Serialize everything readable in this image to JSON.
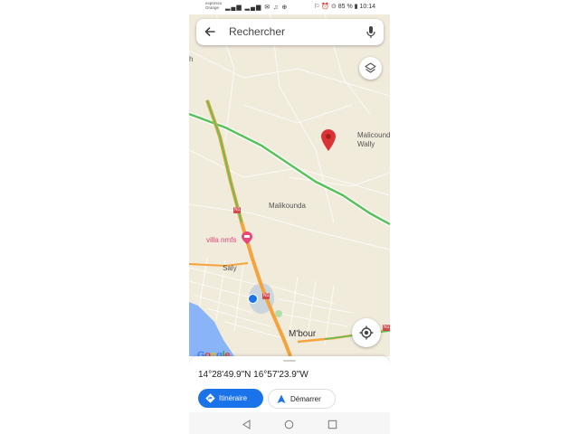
{
  "status_bar": {
    "carrier_line1": "expresso",
    "carrier_line2": "Orange",
    "signal_icons": "▂▄▆ ▂▄▆ ✉ ♫ ⊕",
    "right_text": "⚐ ⏰ ⊙ 85 % ▮ 10:14"
  },
  "search": {
    "placeholder": "Rechercher"
  },
  "map": {
    "labels": {
      "h_edge": "h",
      "malicounda_wally": "Malicounda\nWally",
      "malikounda": "Malikounda",
      "villa": "villa nmfs",
      "saly": "Saly",
      "mbour": "M'bour"
    },
    "shields": {
      "n1_top": "N1",
      "n1_mid": "N1",
      "n1_right": "N1"
    },
    "google_logo": [
      "G",
      "o",
      "o",
      "g",
      "l",
      "e"
    ],
    "colors": {
      "land": "#f1ebdc",
      "highway": "#f5a33c",
      "traffic_green": "#57c25a",
      "water": "#8ab4f8",
      "pin": "#db3236",
      "poi": "#e8477a",
      "location_dot": "#1a73e8"
    }
  },
  "sheet": {
    "coordinates": "14°28'49.9\"N 16°57'23.9\"W",
    "route_label": "Itinéraire",
    "start_label": "Démarrer"
  },
  "icons": {
    "back": "arrow-left",
    "mic": "microphone",
    "layers": "layers",
    "locate": "my-location",
    "route": "directions-diamond",
    "start": "navigation-arrow"
  }
}
